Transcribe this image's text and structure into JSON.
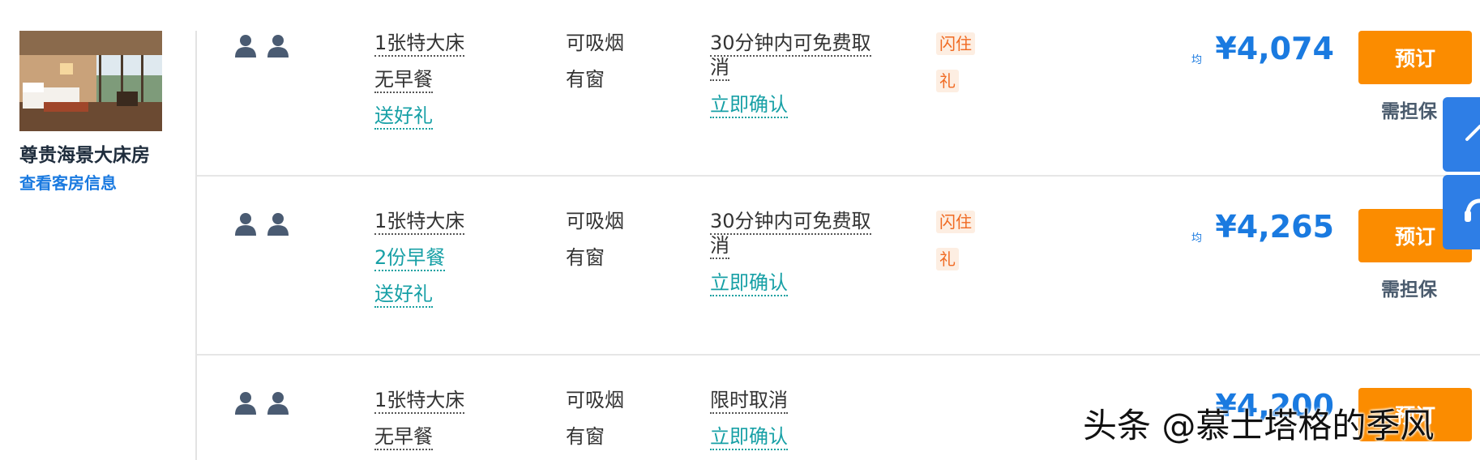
{
  "room": {
    "name": "尊贵海景大床房",
    "info_link": "查看客房信息"
  },
  "rows": [
    {
      "bed": "1张特大床",
      "meal": "无早餐",
      "meal_highlight": false,
      "gift": "送好礼",
      "smoking": "可吸烟",
      "window": "有窗",
      "cancel": "30分钟内可免费取消",
      "confirm": "立即确认",
      "tag1": "闪住",
      "tag2": "礼",
      "avg_label": "均",
      "price": "¥4,074",
      "book": "预订",
      "guarantee": "需担保"
    },
    {
      "bed": "1张特大床",
      "meal": "2份早餐",
      "meal_highlight": true,
      "gift": "送好礼",
      "smoking": "可吸烟",
      "window": "有窗",
      "cancel": "30分钟内可免费取消",
      "confirm": "立即确认",
      "tag1": "闪住",
      "tag2": "礼",
      "avg_label": "均",
      "price": "¥4,265",
      "book": "预订",
      "guarantee": "需担保"
    },
    {
      "bed": "1张特大床",
      "meal": "无早餐",
      "meal_highlight": false,
      "smoking": "可吸烟",
      "window": "有窗",
      "cancel": "限时取消",
      "confirm": "立即确认",
      "price": "¥4,200",
      "book": "预订"
    }
  ],
  "watermark": "头条 @慕士塔格的季风",
  "colors": {
    "accent_blue": "#1a7ae0",
    "book_orange": "#fb8c00",
    "teal_link": "#17a0a6",
    "tag_orange": "#f06a22"
  },
  "icons": [
    "person-icon",
    "room-photo",
    "back-to-top-icon",
    "customer-service-icon"
  ]
}
